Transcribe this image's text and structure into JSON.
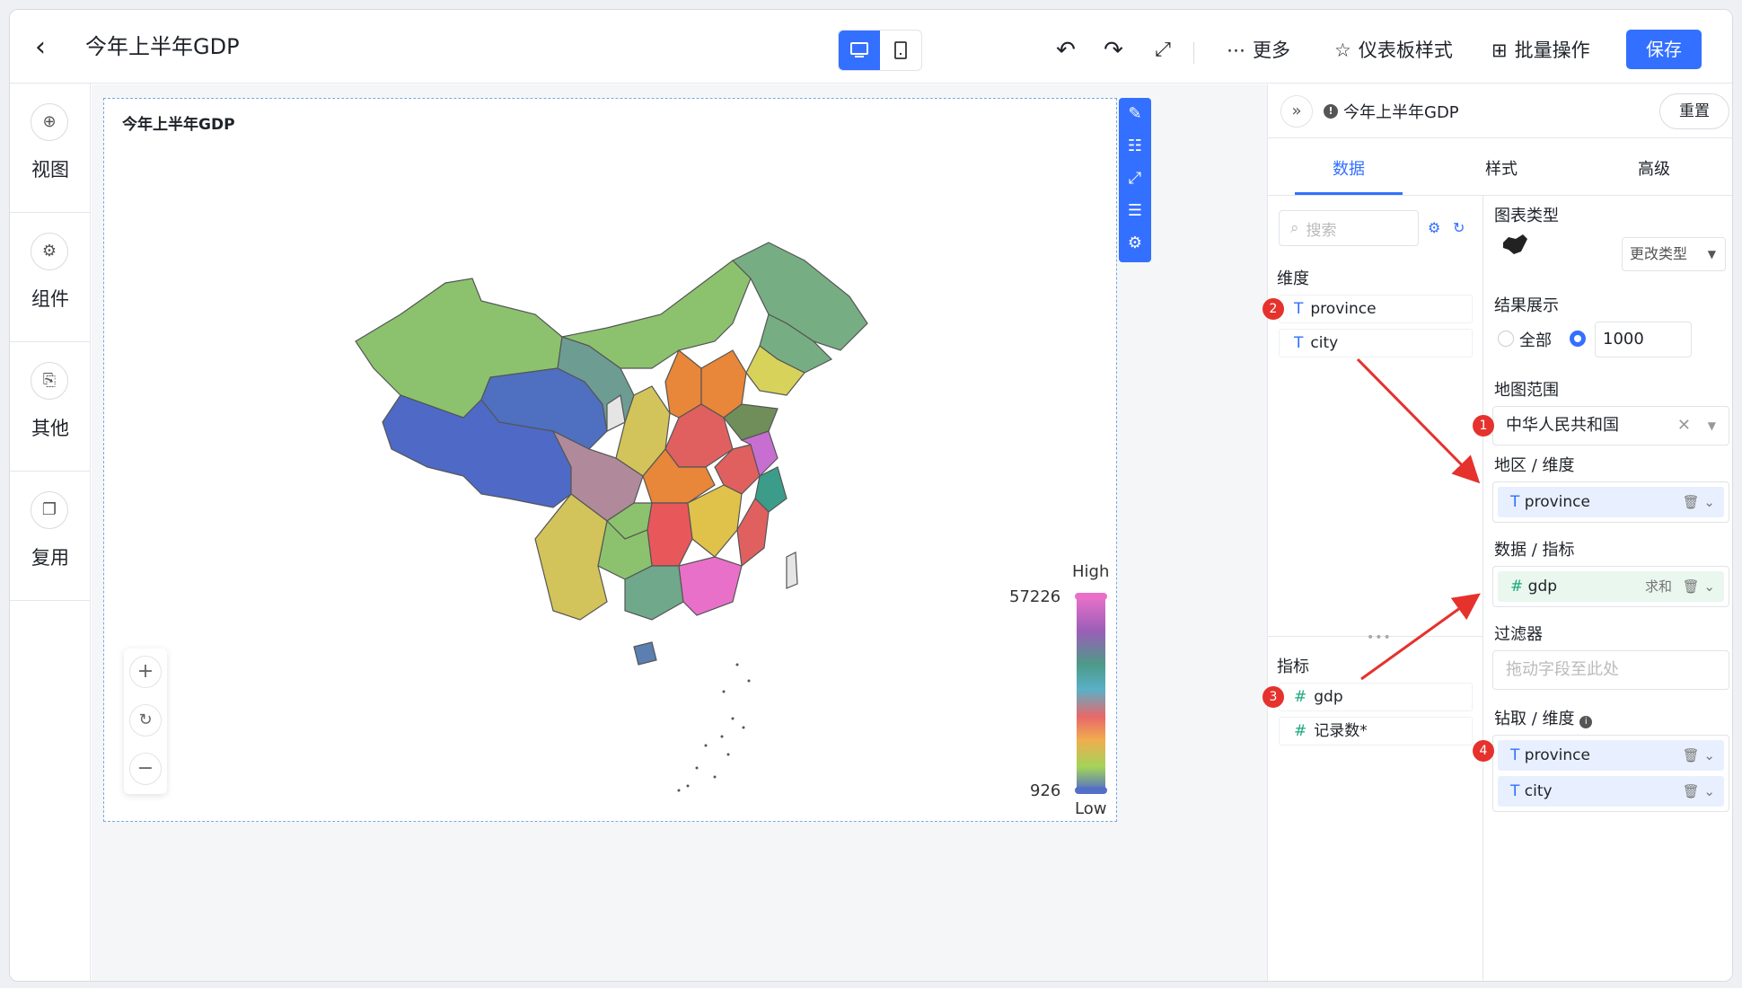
{
  "header": {
    "back_icon": "chevron-left-icon",
    "title": "今年上半年GDP",
    "more_label": "更多",
    "theme_label": "仪表板样式",
    "batch_label": "批量操作",
    "save_label": "保存"
  },
  "sidebar": {
    "items": [
      {
        "label": "视图",
        "icon": "plus-circle-icon"
      },
      {
        "label": "组件",
        "icon": "gear-icon"
      },
      {
        "label": "其他",
        "icon": "stamp-icon"
      },
      {
        "label": "复用",
        "icon": "copy-icon"
      }
    ]
  },
  "chart": {
    "title": "今年上半年GDP"
  },
  "chart_data": {
    "type": "choropleth-map",
    "region": "中华人民共和国",
    "visual_map": {
      "high_label": "High",
      "low_label": "Low",
      "max": 57226,
      "min": 926
    }
  },
  "panel": {
    "title": "今年上半年GDP",
    "reset_label": "重置",
    "tabs": [
      "数据",
      "样式",
      "高级"
    ],
    "search_placeholder": "搜索",
    "dimension_title": "维度",
    "dimensions": [
      "province",
      "city"
    ],
    "measure_title": "指标",
    "measures": [
      "gdp",
      "记录数*"
    ],
    "chart_type_label": "图表类型",
    "change_type_label": "更改类型",
    "result_label": "结果展示",
    "result_all": "全部",
    "result_count": "1000",
    "map_scope_label": "地图范围",
    "map_scope_value": "中华人民共和国",
    "region_dim_label": "地区 / 维度",
    "region_dim_value": "province",
    "data_measure_label": "数据 / 指标",
    "data_measure_value": "gdp",
    "data_measure_agg": "求和",
    "filter_label": "过滤器",
    "filter_placeholder": "拖动字段至此处",
    "drill_label": "钻取 / 维度",
    "drill_items": [
      "province",
      "city"
    ]
  },
  "annotations": {
    "badges": [
      "1",
      "2",
      "3",
      "4"
    ],
    "arrow_color": "#e5322d"
  },
  "colors": {
    "accent": "#3370ff"
  }
}
